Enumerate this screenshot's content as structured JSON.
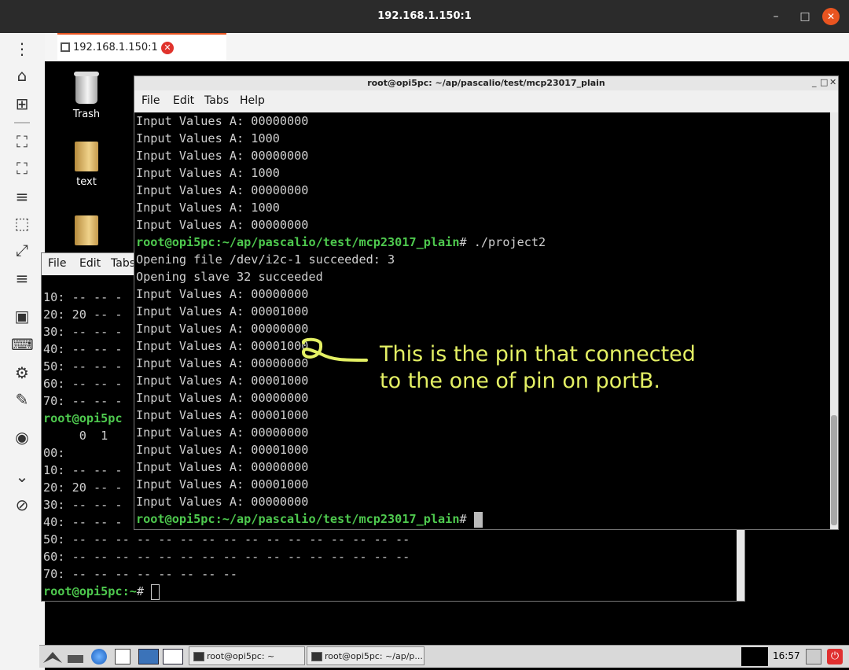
{
  "window": {
    "title": "192.168.1.150:1",
    "min_glyph": "–",
    "max_glyph": "□",
    "close_glyph": "✕"
  },
  "tab": {
    "label": "192.168.1.150:1",
    "close_glyph": "✕"
  },
  "sidebar_icons": [
    "more-icon",
    "home-icon",
    "new-connection-icon",
    "fit-window-icon",
    "fullscreen-icon",
    "menu-icon",
    "resize-icon",
    "scale-icon",
    "menu-icon",
    "windowed-icon",
    "keyboard-icon",
    "settings-icon",
    "tools-icon",
    "screenshot-icon",
    "collapse-icon",
    "disconnect-icon"
  ],
  "desktop": {
    "icons": [
      {
        "label": "Trash"
      },
      {
        "label": "text"
      },
      {
        "label": ""
      }
    ]
  },
  "terminal_back": {
    "menu": [
      "File",
      "Edit",
      "Tabs"
    ],
    "lines": [
      {
        "prompt": "",
        "text": "10: -- -- -"
      },
      {
        "prompt": "",
        "text": "20: 20 -- -"
      },
      {
        "prompt": "",
        "text": "30: -- -- -"
      },
      {
        "prompt": "",
        "text": "40: -- -- -"
      },
      {
        "prompt": "",
        "text": "50: -- -- -"
      },
      {
        "prompt": "",
        "text": "60: -- -- -"
      },
      {
        "prompt": "",
        "text": "70: -- -- -"
      },
      {
        "prompt": "root@opi5pc",
        "text": ""
      },
      {
        "prompt": "",
        "text": "     0  1"
      },
      {
        "prompt": "",
        "text": "00:"
      },
      {
        "prompt": "",
        "text": "10: -- -- -"
      },
      {
        "prompt": "",
        "text": "20: 20 -- -"
      },
      {
        "prompt": "",
        "text": "30: -- -- -"
      },
      {
        "prompt": "",
        "text": "40: -- -- -"
      },
      {
        "prompt": "",
        "text": "50: -- -- -- -- -- -- -- -- -- -- -- -- -- -- -- --"
      },
      {
        "prompt": "",
        "text": "60: -- -- -- -- -- -- -- -- -- -- -- -- -- -- -- --"
      },
      {
        "prompt": "",
        "text": "70: -- -- -- -- -- -- -- --"
      }
    ],
    "last_prompt": "root@opi5pc:~",
    "last_prompt_suffix": "# "
  },
  "terminal_front": {
    "title": "root@opi5pc: ~/ap/pascalio/test/mcp23017_plain",
    "menu": [
      "File",
      "Edit",
      "Tabs",
      "Help"
    ],
    "lines": [
      {
        "prompt": "",
        "text": "Input Values A: 00000000"
      },
      {
        "prompt": "",
        "text": "Input Values A: 1000"
      },
      {
        "prompt": "",
        "text": "Input Values A: 00000000"
      },
      {
        "prompt": "",
        "text": "Input Values A: 1000"
      },
      {
        "prompt": "",
        "text": "Input Values A: 00000000"
      },
      {
        "prompt": "",
        "text": "Input Values A: 1000"
      },
      {
        "prompt": "",
        "text": "Input Values A: 00000000"
      },
      {
        "prompt": "root@opi5pc:~/ap/pascalio/test/mcp23017_plain",
        "text": "# ./project2"
      },
      {
        "prompt": "",
        "text": "Opening file /dev/i2c-1 succeeded: 3"
      },
      {
        "prompt": "",
        "text": "Opening slave 32 succeeded"
      },
      {
        "prompt": "",
        "text": "Input Values A: 00000000"
      },
      {
        "prompt": "",
        "text": "Input Values A: 00001000"
      },
      {
        "prompt": "",
        "text": "Input Values A: 00000000"
      },
      {
        "prompt": "",
        "text": "Input Values A: 00001000"
      },
      {
        "prompt": "",
        "text": "Input Values A: 00000000"
      },
      {
        "prompt": "",
        "text": "Input Values A: 00001000"
      },
      {
        "prompt": "",
        "text": "Input Values A: 00000000"
      },
      {
        "prompt": "",
        "text": "Input Values A: 00001000"
      },
      {
        "prompt": "",
        "text": "Input Values A: 00000000"
      },
      {
        "prompt": "",
        "text": "Input Values A: 00001000"
      },
      {
        "prompt": "",
        "text": "Input Values A: 00000000"
      },
      {
        "prompt": "",
        "text": "Input Values A: 00001000"
      },
      {
        "prompt": "",
        "text": "Input Values A: 00000000"
      }
    ],
    "last_prompt": "root@opi5pc:~/ap/pascalio/test/mcp23017_plain",
    "last_prompt_suffix": "# "
  },
  "annotation": {
    "line1": "This is the pin that connected",
    "line2": "to the one of pin on portB.",
    "color": "#e4f064"
  },
  "taskbar": {
    "tasks": [
      {
        "label": "root@opi5pc: ~"
      },
      {
        "label": "root@opi5pc: ~/ap/p..."
      }
    ],
    "clock": "16:57"
  },
  "colors": {
    "accent": "#e95420",
    "prompt_green": "#4ec94e",
    "terminal_text": "#cfcfcf"
  }
}
